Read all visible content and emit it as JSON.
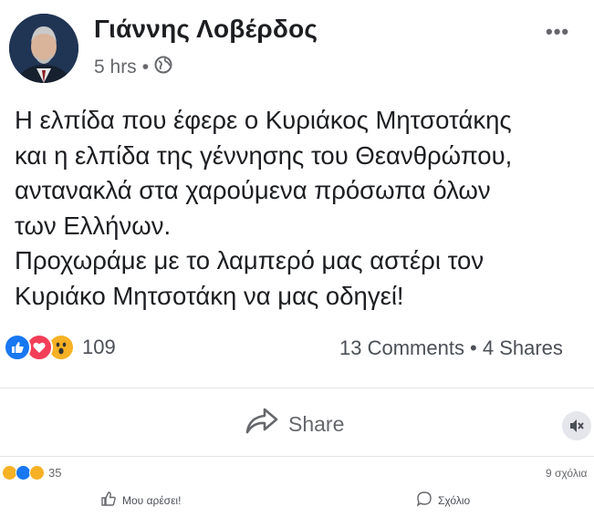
{
  "post": {
    "author": "Γιάννης Λοβέρδος",
    "time": "5 hrs",
    "separator": "•",
    "more": "•••",
    "text_lines": [
      "Η ελπίδα που έφερε ο Κυριάκος Μητσοτάκης",
      "και η ελπίδα της γέννησης του Θεανθρώπου,",
      "αντανακλά στα χαρούμενα πρόσωπα όλων",
      "των Ελλήνων.",
      "Προχωράμε με το λαμπερό μας αστέρι τον",
      "Κυριάκο Μητσοτάκη να μας οδηγεί!"
    ]
  },
  "reactions": {
    "count": "109",
    "stats": "13 Comments • 4 Shares",
    "icons": [
      "like-icon",
      "love-icon",
      "wow-icon"
    ]
  },
  "actions": {
    "share_label": "Share"
  },
  "lower": {
    "reaction_count": "35",
    "time": "9 σχόλια",
    "like_label": "Μου αρέσει!",
    "comment_label": "Σχόλιο"
  },
  "colors": {
    "like": "#1877f2",
    "love": "#f33e58",
    "wow": "#f7b125",
    "text": "#1c1e21",
    "muted": "#65676b"
  }
}
